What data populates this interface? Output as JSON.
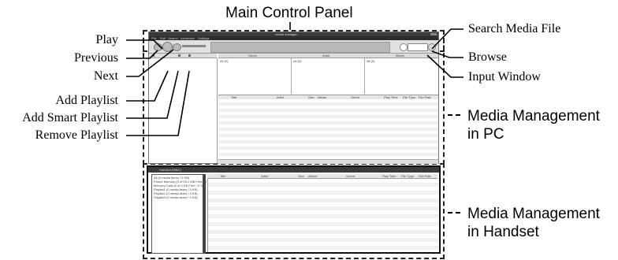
{
  "header": {
    "main_control_panel": "Main Control Panel"
  },
  "callouts_left": {
    "play": "Play",
    "previous": "Previous",
    "next": "Next",
    "add_playlist": "Add Playlist",
    "add_smart_playlist": "Add Smart Playlist",
    "remove_playlist": "Remove Playlist"
  },
  "callouts_right": {
    "search_media_file": "Search Media File",
    "browse": "Browse",
    "input_window": "Input Window"
  },
  "sections": {
    "pc_line1": "Media Management",
    "pc_line2": "in PC",
    "handset_line1": "Media Management",
    "handset_line2": "in Handset"
  },
  "app": {
    "title": "media manager",
    "menu": [
      "File",
      "Edit",
      "Search",
      "Advanced",
      "Settings"
    ],
    "browser_columns": [
      "Genre",
      "Artist",
      "Album"
    ],
    "browser_filters": [
      "All (0)",
      "All (0)",
      "All (0)"
    ],
    "track_columns": [
      "Title",
      "Artist",
      "Size",
      "Album",
      "Genre",
      "Play Time",
      "File Type",
      "File Path"
    ],
    "handset_title": "Handset (MMC)",
    "handset_tree": [
      "All (0 media items / 0 KB)",
      "Phone Memory (0 of 93.1 MB Free / 0 %)",
      "Memory Card (0 of 0 KB Free / 0 %)",
      "Playlist1 (0 media items / 0 KB)",
      "Playlist2 (0 media items / 0 KB)",
      "Playlist3 (0 media items / 0 KB)"
    ],
    "handset_columns": [
      "Title",
      "Artist",
      "Size",
      "Album",
      "Genre",
      "Play Time",
      "File Type",
      "File Path"
    ]
  }
}
